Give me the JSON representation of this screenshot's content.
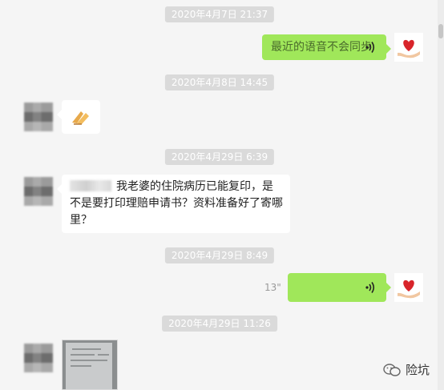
{
  "timestamps": [
    "2020年4月7日 21:37",
    "2020年4月8日 14:45",
    "2020年4月29日 6:39",
    "2020年4月29日 8:49",
    "2020年4月29日 11:26"
  ],
  "messages": {
    "voice_transcript": "最近的语音不会同步",
    "long_text": "我老婆的住院病历已能复印，是不是要打印理赔申请书？资料准备好了寄哪里？",
    "voice_duration": "13\""
  },
  "watermark": {
    "label": "险坑"
  },
  "colors": {
    "background": "#f5f5f5",
    "green_bubble": "#a0e75a",
    "time_chip": "#dadada"
  }
}
